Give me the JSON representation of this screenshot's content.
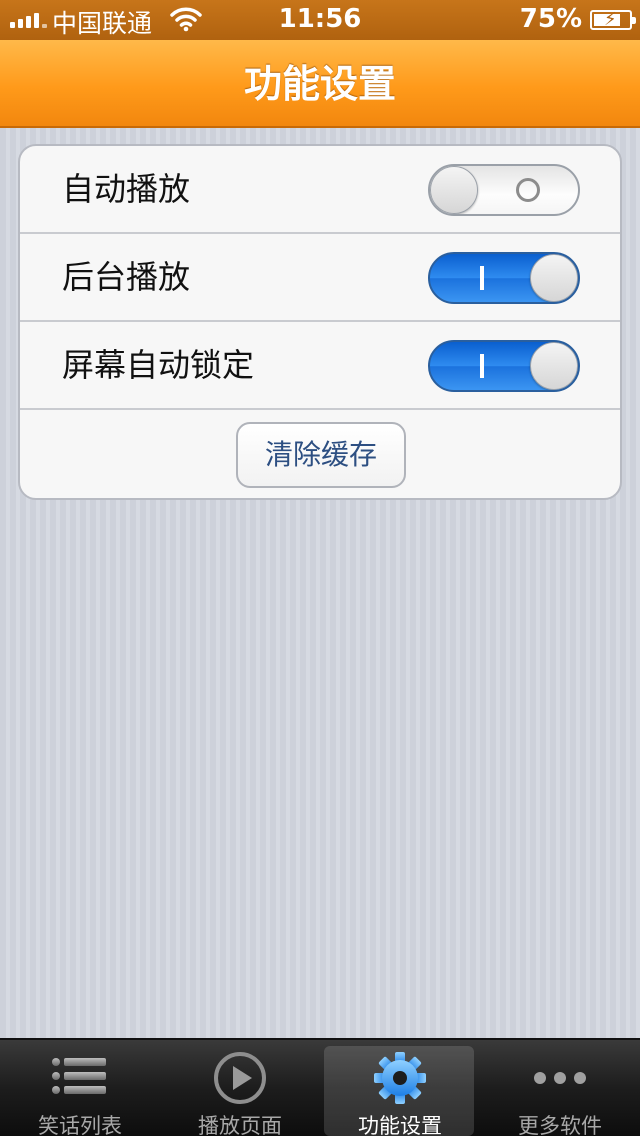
{
  "status_bar": {
    "carrier": "中国联通",
    "time": "11:56",
    "battery": "75%",
    "battery_level": 0.75,
    "icons": [
      "signal-icon",
      "wifi-icon",
      "battery-charging-icon"
    ]
  },
  "nav": {
    "title": "功能设置"
  },
  "settings": {
    "rows": [
      {
        "label": "自动播放",
        "toggle_on": false
      },
      {
        "label": "后台播放",
        "toggle_on": true
      },
      {
        "label": "屏幕自动锁定",
        "toggle_on": true
      }
    ],
    "clear_cache_label": "清除缓存"
  },
  "tab_bar": {
    "tabs": [
      {
        "label": "笑话列表",
        "icon": "list-icon",
        "active": false
      },
      {
        "label": "播放页面",
        "icon": "play-icon",
        "active": false
      },
      {
        "label": "功能设置",
        "icon": "gear-icon",
        "active": true
      },
      {
        "label": "更多软件",
        "icon": "more-icon",
        "active": false
      }
    ]
  },
  "colors": {
    "nav_orange": "#ff9a1a",
    "toggle_blue": "#2f8cf0",
    "active_tab_icon": "#3a9cf5"
  }
}
